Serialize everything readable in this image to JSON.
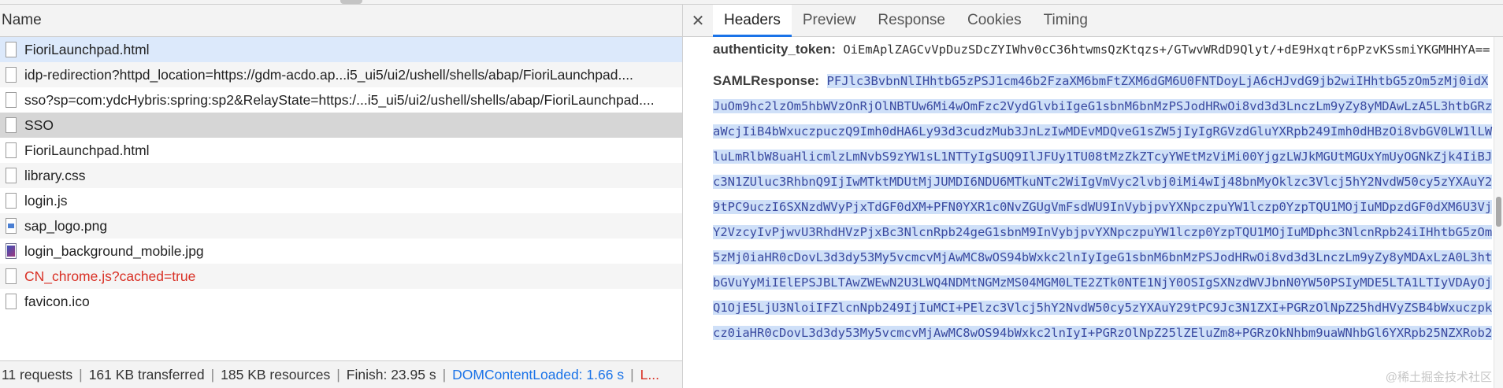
{
  "network": {
    "column_header": "Name",
    "rows": [
      {
        "name": "FioriLaunchpad.html",
        "icon": "document-icon",
        "state": "selected"
      },
      {
        "name": "idp-redirection?httpd_location=https://gdm-acdo.ap...i5_ui5/ui2/ushell/shells/abap/FioriLaunchpad....",
        "icon": "document-icon",
        "state": "normal"
      },
      {
        "name": "sso?sp=com:ydcHybris:spring:sp2&RelayState=https:/...i5_ui5/ui2/ushell/shells/abap/FioriLaunchpad....",
        "icon": "document-icon",
        "state": "normal"
      },
      {
        "name": "SSO",
        "icon": "document-icon",
        "state": "highlight"
      },
      {
        "name": "FioriLaunchpad.html",
        "icon": "document-icon",
        "state": "normal"
      },
      {
        "name": "library.css",
        "icon": "document-icon",
        "state": "normal"
      },
      {
        "name": "login.js",
        "icon": "document-icon",
        "state": "normal"
      },
      {
        "name": "sap_logo.png",
        "icon": "image-icon",
        "state": "normal"
      },
      {
        "name": "login_background_mobile.jpg",
        "icon": "image-icon",
        "state": "normal"
      },
      {
        "name": "CN_chrome.js?cached=true",
        "icon": "document-icon",
        "state": "error"
      },
      {
        "name": "favicon.ico",
        "icon": "document-icon",
        "state": "normal"
      }
    ]
  },
  "status": {
    "requests": "11 requests",
    "transferred": "161 KB transferred",
    "resources": "185 KB resources",
    "finish": "Finish: 23.95 s",
    "dom_loaded": "DOMContentLoaded: 1.66 s",
    "load": "L..."
  },
  "detail": {
    "close_glyph": "✕",
    "tabs": [
      "Headers",
      "Preview",
      "Response",
      "Cookies",
      "Timing"
    ],
    "active_tab": "Headers",
    "authenticity_key": "authenticity_token:",
    "authenticity_value": "OiEmAplZAGCvVpDuzSDcZYIWhv0cC36htwmsQzKtqzs+/GTwvWRdD9Qlyt/+dE9Hxqtr6pPzvKSsmiYKGMHHYA==",
    "saml_key": "SAMLResponse:",
    "saml_value": "PFJlc3BvbnNlIHhtbG5zPSJ1cm46b2FzaXM6bmFtZXM6dGM6U0FNTDoyLjA6cHJvdG9jb2wiIHhtbG5zOm5zMj0idXJuOm9hc2lzOm5hbWVzOnRjOlNBTUw6Mi4wOmFzc2VydGlvbiIgeG1sbnM6bnMzPSJodHRwOi8vd3d3LnczLm9yZy8yMDAwLzA5L3htbGRzaWcjIiB4bWxuczpuczQ9Imh0dHA6Ly93d3cudzMub3JnLzIwMDEvMDQveG1sZW5jIyIgRGVzdGluYXRpb249Imh0dHBzOi8vbGV0LW1lLWluLmRlbW8uaHlicmlzLmNvbS9zYW1sL1NTTyIgSUQ9IlJFUy1TU08tMzZkZTcyYWEtMzViMi00YjgzLWJkMGUtMGUxYmUyOGNkZjk4IiBJc3N1ZUluc3RhbnQ9IjIwMTktMDUtMjJUMDI6NDU6MTkuNTc2WiIgVmVyc2lvbj0iMi4wIj48bnMyOklzc3Vlcj5hY2NvdW50cy5zYXAuY29tPC9uczI6SXNzdWVyPjxTdGF0dXM+PFN0YXR1c0NvZGUgVmFsdWU9InVybjpvYXNpczpuYW1lczp0YzpTQU1MOjIuMDpzdGF0dXM6U3VjY2VzcyIvPjwvU3RhdHVzPjxBc3NlcnRpb24geG1sbnM9InVybjpvYXNpczpuYW1lczp0YzpTQU1MOjIuMDphc3NlcnRpb24iIHhtbG5zOm5zMj0iaHR0cDovL3d3dy53My5vcmcvMjAwMC8wOS94bWxkc2lnIyIgeG1sbnM6bnMzPSJodHRwOi8vd3d3LnczLm9yZy8yMDAxLzA0L3htbGVuYyMiIElEPSJBLTAwZWEwN2U3LWQ4NDMtNGMzMS04MGM0LTE2ZTk0NTE1NjY0OSIgSXNzdWVJbnN0YW50PSIyMDE5LTA1LTIyVDAyOjQ1OjE5LjU3NloiIFZlcnNpb249IjIuMCI+PElzc3Vlcj5hY2NvdW50cy5zYXAuY29tPC9Jc3N1ZXI+PGRzOlNpZ25hdHVyZSB4bWxuczpkcz0iaHR0cDovL3d3dy53My5vcmcvMjAwMC8wOS94bWxkc2lnIyI+PGRzOlNpZ25lZEluZm8+PGRzOkNhbm9uaWNhbGl6YXRpb25NZXRob2"
  },
  "watermark": "@稀土掘金技术社区"
}
